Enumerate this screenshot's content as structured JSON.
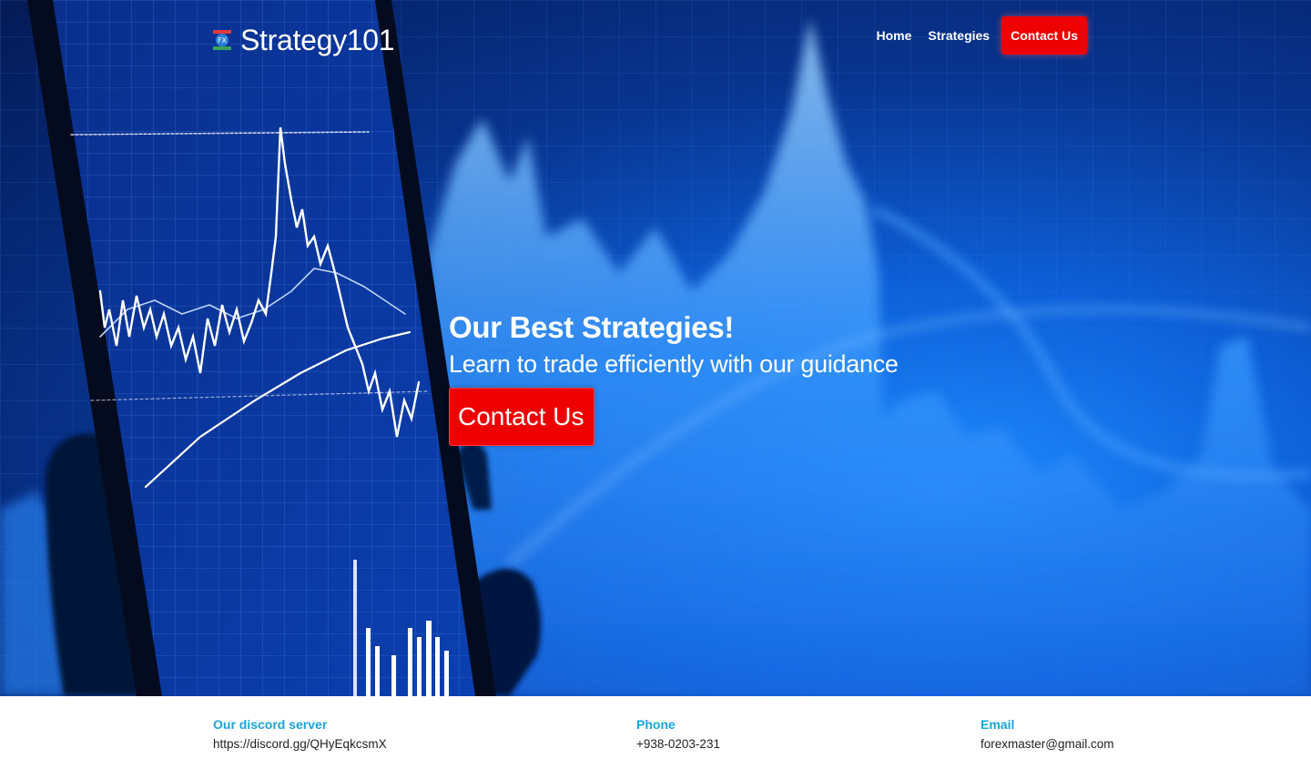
{
  "brand": {
    "name": "Strategy101",
    "logo_text": "FX",
    "logo_icon": "forex-logo-icon"
  },
  "nav": {
    "items": [
      {
        "label": "Home"
      },
      {
        "label": "Strategies"
      },
      {
        "label": "Contact Us",
        "active": true
      }
    ]
  },
  "hero": {
    "title": "Our Best Strategies!",
    "subtitle": "Learn to trade efficiently with our guidance",
    "cta_label": "Contact Us",
    "background": "trading-chart-phone-photo"
  },
  "footer": {
    "columns": [
      {
        "heading": "Our discord server",
        "value": "https://discord.gg/QHyEqkcsmX"
      },
      {
        "heading": "Phone",
        "value": "+938-0203-231"
      },
      {
        "heading": "Email",
        "value": "forexmaster@gmail.com"
      }
    ]
  },
  "colors": {
    "accent_red": "#ee0000",
    "footer_heading": "#1aa3d9",
    "hero_blue": "#0d5fd8"
  }
}
